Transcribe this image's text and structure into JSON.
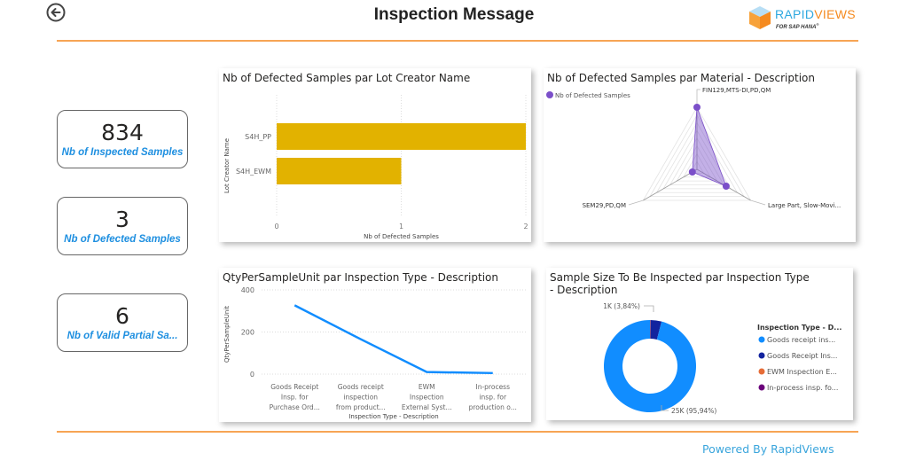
{
  "header": {
    "title": "Inspection Message",
    "back_icon": "circle-arrow-left-icon",
    "logo": {
      "brand_a": "RAPID",
      "brand_b": "VIEWS",
      "sub": "FOR SAP HANA",
      "reg": "®"
    }
  },
  "colors": {
    "accent": "#f7a555",
    "kpi_label": "#1e8fe0",
    "bar": "#e2b200",
    "line": "#118dff",
    "radar": "#7b4fc9",
    "footer": "#3aa5dc"
  },
  "kpis": [
    {
      "value": "834",
      "label": "Nb of Inspected Samples"
    },
    {
      "value": "3",
      "label": "Nb of Defected Samples"
    },
    {
      "value": "6",
      "label": "Nb of Valid Partial Sa..."
    }
  ],
  "footer": {
    "text": "Powered By RapidViews"
  },
  "chart_data": [
    {
      "type": "bar",
      "orientation": "horizontal",
      "title": "Nb of Defected Samples par Lot Creator Name",
      "categories": [
        "S4H_PP",
        "S4H_EWM"
      ],
      "values": [
        2,
        1
      ],
      "xlabel": "Nb of Defected Samples",
      "ylabel": "Lot Creator Name",
      "xlim": [
        0,
        2
      ],
      "xticks": [
        "0",
        "1",
        "2"
      ],
      "grid": true
    },
    {
      "type": "radar",
      "title": "Nb of Defected Samples par Material - Description",
      "legend": [
        "Nb of Defected Samples"
      ],
      "legend_position": "top-left",
      "categories": [
        "FIN129,MTS-DI,PD,QM",
        "Large Part, Slow-Movi...",
        "SEM29,PD,QM"
      ],
      "values": [
        2,
        1,
        0
      ],
      "max": 2
    },
    {
      "type": "line",
      "title": "QtyPerSampleUnit par Inspection Type - Description",
      "categories": [
        [
          "Goods Receipt",
          "Insp. for",
          "Purchase Ord..."
        ],
        [
          "Goods receipt",
          "inspection",
          "from product..."
        ],
        [
          "EWM",
          "Inspection",
          "External Syst..."
        ],
        [
          "In-process",
          "insp. for",
          "production o..."
        ]
      ],
      "values": [
        327,
        166,
        10,
        5
      ],
      "xlabel": "Inspection Type - Description",
      "ylabel": "QtyPerSampleUnit",
      "ylim": [
        0,
        400
      ],
      "yticks": [
        "0",
        "200",
        "400"
      ],
      "grid": true
    },
    {
      "type": "pie",
      "donut": true,
      "title": "Sample Size To Be Inspected par Inspection Type - Description",
      "legend_title": "Inspection Type - D...",
      "legend_position": "right",
      "slices": [
        {
          "label": "Goods receipt ins...",
          "percent": 95.94,
          "color": "#118dff",
          "data_label": "25K (95,94%)"
        },
        {
          "label": "Goods Receipt Ins...",
          "percent": 3.84,
          "color": "#12239e",
          "data_label": "1K (3,84%)"
        },
        {
          "label": "EWM Inspection E...",
          "percent": 0.12,
          "color": "#e66c37",
          "data_label": ""
        },
        {
          "label": "In-process insp. fo...",
          "percent": 0.1,
          "color": "#6b007b",
          "data_label": ""
        }
      ]
    }
  ]
}
